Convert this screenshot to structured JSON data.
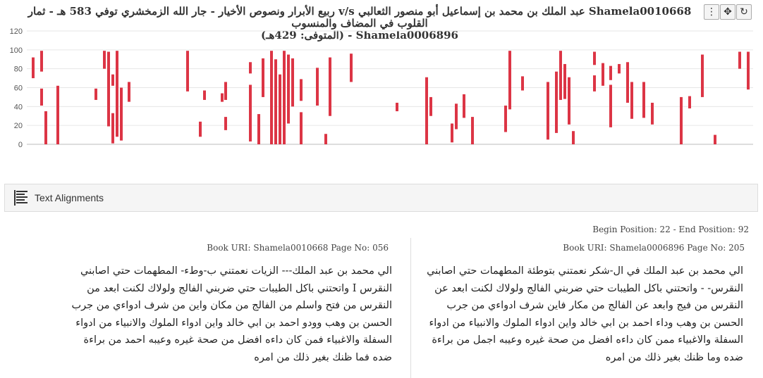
{
  "toolbar": {
    "menu_icon": "⋮",
    "move_icon": "✥",
    "reset_icon": "↻",
    "extra_icon": "▢"
  },
  "chart_title": {
    "line1": "Shamela0010668 عبد الملك بن محمد بن إسماعيل أبو منصور الثعالبي v/s ربيع الأبرار ونصوص الأخيار - جار الله الزمخشري توفي 583 هـ - ثمار القلوب في المضاف والمنسوب",
    "line2": "Shamela0006896 - (المتوفى: 429هـ)"
  },
  "chart_data": {
    "type": "bar",
    "subtype": "range-bars",
    "ylim": [
      0,
      120
    ],
    "y_ticks": [
      0,
      20,
      40,
      60,
      80,
      100,
      120
    ],
    "grid": true,
    "bar_color": "#dc3545",
    "bars": [
      {
        "x": 47,
        "y0": 70,
        "y1": 92
      },
      {
        "x": 59,
        "y0": 77,
        "y1": 99
      },
      {
        "x": 59,
        "y0": 41,
        "y1": 59
      },
      {
        "x": 65,
        "y0": 0,
        "y1": 35
      },
      {
        "x": 82,
        "y0": 0,
        "y1": 62
      },
      {
        "x": 136,
        "y0": 47,
        "y1": 59
      },
      {
        "x": 148,
        "y0": 80,
        "y1": 99
      },
      {
        "x": 154,
        "y0": 19,
        "y1": 98
      },
      {
        "x": 160,
        "y0": 62,
        "y1": 74
      },
      {
        "x": 160,
        "y0": 1,
        "y1": 33
      },
      {
        "x": 166,
        "y0": 8,
        "y1": 99
      },
      {
        "x": 172,
        "y0": 4,
        "y1": 60
      },
      {
        "x": 183,
        "y0": 45,
        "y1": 66
      },
      {
        "x": 266,
        "y0": 56,
        "y1": 99
      },
      {
        "x": 284,
        "y0": 8,
        "y1": 24
      },
      {
        "x": 290,
        "y0": 47,
        "y1": 57
      },
      {
        "x": 315,
        "y0": 45,
        "y1": 54
      },
      {
        "x": 320,
        "y0": 47,
        "y1": 66
      },
      {
        "x": 320,
        "y0": 15,
        "y1": 29
      },
      {
        "x": 355,
        "y0": 75,
        "y1": 87
      },
      {
        "x": 355,
        "y0": 3,
        "y1": 63
      },
      {
        "x": 367,
        "y0": 0,
        "y1": 32
      },
      {
        "x": 373,
        "y0": 50,
        "y1": 91
      },
      {
        "x": 385,
        "y0": 0,
        "y1": 99
      },
      {
        "x": 391,
        "y0": 0,
        "y1": 90
      },
      {
        "x": 397,
        "y0": 0,
        "y1": 74
      },
      {
        "x": 403,
        "y0": 38,
        "y1": 99
      },
      {
        "x": 403,
        "y0": 0,
        "y1": 38
      },
      {
        "x": 409,
        "y0": 22,
        "y1": 95
      },
      {
        "x": 415,
        "y0": 40,
        "y1": 91
      },
      {
        "x": 427,
        "y0": 46,
        "y1": 69
      },
      {
        "x": 427,
        "y0": 0,
        "y1": 34
      },
      {
        "x": 450,
        "y0": 41,
        "y1": 81
      },
      {
        "x": 462,
        "y0": 0,
        "y1": 11
      },
      {
        "x": 468,
        "y0": 30,
        "y1": 92
      },
      {
        "x": 498,
        "y0": 66,
        "y1": 96
      },
      {
        "x": 563,
        "y0": 35,
        "y1": 44
      },
      {
        "x": 605,
        "y0": 0,
        "y1": 71
      },
      {
        "x": 611,
        "y0": 30,
        "y1": 50
      },
      {
        "x": 641,
        "y0": 2,
        "y1": 22
      },
      {
        "x": 647,
        "y0": 16,
        "y1": 43
      },
      {
        "x": 658,
        "y0": 28,
        "y1": 53
      },
      {
        "x": 670,
        "y0": 0,
        "y1": 29
      },
      {
        "x": 717,
        "y0": 13,
        "y1": 41
      },
      {
        "x": 723,
        "y0": 37,
        "y1": 99
      },
      {
        "x": 741,
        "y0": 57,
        "y1": 72
      },
      {
        "x": 777,
        "y0": 5,
        "y1": 66
      },
      {
        "x": 789,
        "y0": 12,
        "y1": 77
      },
      {
        "x": 795,
        "y0": 50,
        "y1": 99
      },
      {
        "x": 795,
        "y0": 47,
        "y1": 72
      },
      {
        "x": 801,
        "y0": 48,
        "y1": 85
      },
      {
        "x": 807,
        "y0": 21,
        "y1": 71
      },
      {
        "x": 813,
        "y0": 0,
        "y1": 14
      },
      {
        "x": 843,
        "y0": 56,
        "y1": 73
      },
      {
        "x": 843,
        "y0": 84,
        "y1": 98
      },
      {
        "x": 855,
        "y0": 62,
        "y1": 86
      },
      {
        "x": 866,
        "y0": 18,
        "y1": 63
      },
      {
        "x": 866,
        "y0": 68,
        "y1": 83
      },
      {
        "x": 878,
        "y0": 75,
        "y1": 85
      },
      {
        "x": 890,
        "y0": 44,
        "y1": 87
      },
      {
        "x": 896,
        "y0": 27,
        "y1": 66
      },
      {
        "x": 913,
        "y0": 28,
        "y1": 66
      },
      {
        "x": 925,
        "y0": 21,
        "y1": 44
      },
      {
        "x": 966,
        "y0": 0,
        "y1": 50
      },
      {
        "x": 978,
        "y0": 38,
        "y1": 51
      },
      {
        "x": 996,
        "y0": 50,
        "y1": 95
      },
      {
        "x": 1014,
        "y0": 0,
        "y1": 10
      },
      {
        "x": 1049,
        "y0": 80,
        "y1": 98
      },
      {
        "x": 1061,
        "y0": 58,
        "y1": 98
      }
    ]
  },
  "alignment_panel": {
    "label": "Text Alignments",
    "icon": "list-icon"
  },
  "positions": "Begin Position: 22 - End Position: 92",
  "left_book": {
    "uri": "Book URI: Shamela0010668 Page No: 056",
    "text": "الي محمد بن عبد الملك--- الزيات نعمتني ب-وطء- المطهمات حتي اصابني النقرس I واتحتني باكل الطيبات حتي ضربني الفالج ولولاك لكنت ابعد من النقرس من فتح واسلم من الفالج من مكان واين من شرف ادواءي من جرب الحسن بن وهب وودو احمد بن ابي خالد واين ادواء الملوك والانبياء من ادواء السفلة والاغبياء فمن كان داءه افضل من صحة غيره وعيبه احمد من براءة ضده فما ظنك بغير ذلك من امره"
  },
  "right_book": {
    "uri": "Book URI: Shamela0006896 Page No: 205",
    "text": "الي محمد بن عبد الملك في ال-شكر نعمتني بتوطئة المطهمات حتي اصابني النقرس- - واتحتني باكل الطيبات حتي ضربني الفالج ولولاك لكنت ابعد عن النقرس من فيج وابعد عن الفالج من مكار فاين شرف ادواءي من جرب الحسن بن وهب وداء احمد بن ابي خالد واين ادواء الملوك والانبياء من ادواء السفلة والاغبياء ممن كان داءه افضل من صحة غيره وعيبه اجمل من براءة ضده وما ظنك بغير ذلك من امره"
  }
}
